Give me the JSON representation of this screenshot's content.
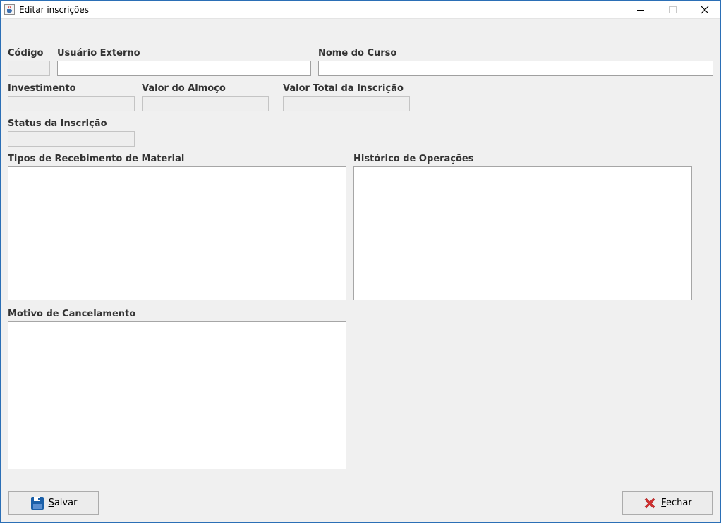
{
  "window": {
    "title": "Editar inscrições",
    "icon": "java-cup-icon",
    "controls": [
      "minimize-icon",
      "maximize-icon",
      "close-icon"
    ]
  },
  "form": {
    "codigo": {
      "label": "Código",
      "value": ""
    },
    "usuario_externo": {
      "label": "Usuário Externo",
      "value": ""
    },
    "nome_curso": {
      "label": "Nome do Curso",
      "value": ""
    },
    "investimento": {
      "label": "Investimento",
      "value": ""
    },
    "valor_almoco": {
      "label": "Valor do Almoço",
      "value": ""
    },
    "valor_total": {
      "label": "Valor Total da Inscrição",
      "value": ""
    },
    "status": {
      "label": "Status da Inscrição",
      "value": ""
    },
    "tipos_recebimento": {
      "label": "Tipos de Recebimento de Material",
      "items": []
    },
    "historico": {
      "label": "Histórico de Operações",
      "items": []
    },
    "motivo_cancelamento": {
      "label": "Motivo de Cancelamento",
      "value": ""
    }
  },
  "buttons": {
    "salvar": {
      "mnemonic": "S",
      "rest": "alvar",
      "icon": "floppy-disk-icon",
      "color": "#1a5fa8"
    },
    "fechar": {
      "mnemonic": "F",
      "rest": "echar",
      "icon": "red-x-icon",
      "color": "#d32f2f"
    }
  }
}
